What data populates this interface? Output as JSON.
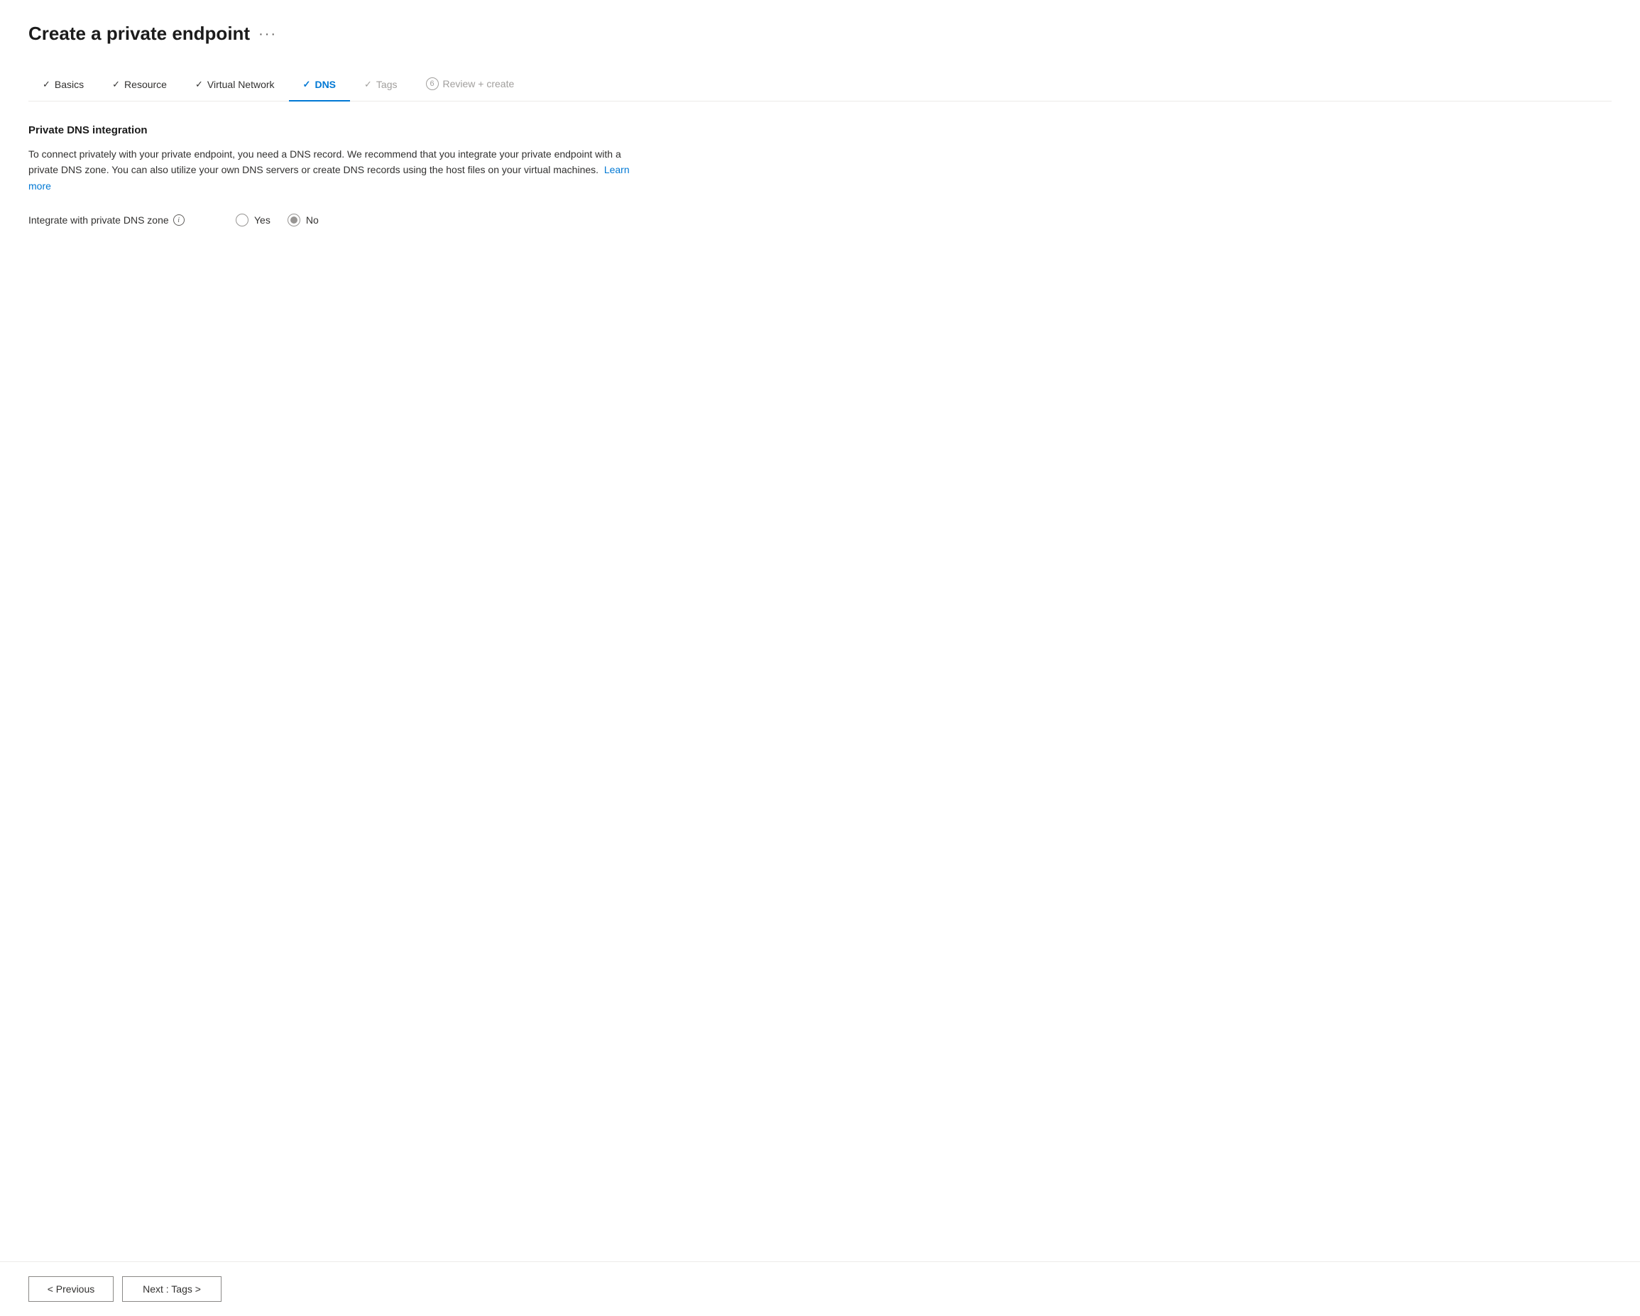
{
  "page": {
    "title": "Create a private endpoint",
    "ellipsis": "···"
  },
  "wizard": {
    "tabs": [
      {
        "id": "basics",
        "label": "Basics",
        "state": "completed",
        "check": "✓",
        "number": null
      },
      {
        "id": "resource",
        "label": "Resource",
        "state": "completed",
        "check": "✓",
        "number": null
      },
      {
        "id": "virtual-network",
        "label": "Virtual Network",
        "state": "completed",
        "check": "✓",
        "number": null
      },
      {
        "id": "dns",
        "label": "DNS",
        "state": "active",
        "check": "✓",
        "number": null
      },
      {
        "id": "tags",
        "label": "Tags",
        "state": "disabled",
        "check": "✓",
        "number": null
      },
      {
        "id": "review-create",
        "label": "Review + create",
        "state": "disabled",
        "check": null,
        "number": "6"
      }
    ]
  },
  "content": {
    "section_title": "Private DNS integration",
    "description_part1": "To connect privately with your private endpoint, you need a DNS record. We recommend that you integrate your private endpoint with a private DNS zone. You can also utilize your own DNS servers or create DNS records using the host files on your virtual machines.",
    "learn_more_label": "Learn more",
    "form": {
      "label": "Integrate with private DNS zone",
      "options": [
        {
          "id": "yes",
          "label": "Yes",
          "selected": false
        },
        {
          "id": "no",
          "label": "No",
          "selected": true
        }
      ]
    }
  },
  "footer": {
    "previous_label": "< Previous",
    "next_label": "Next : Tags >"
  }
}
